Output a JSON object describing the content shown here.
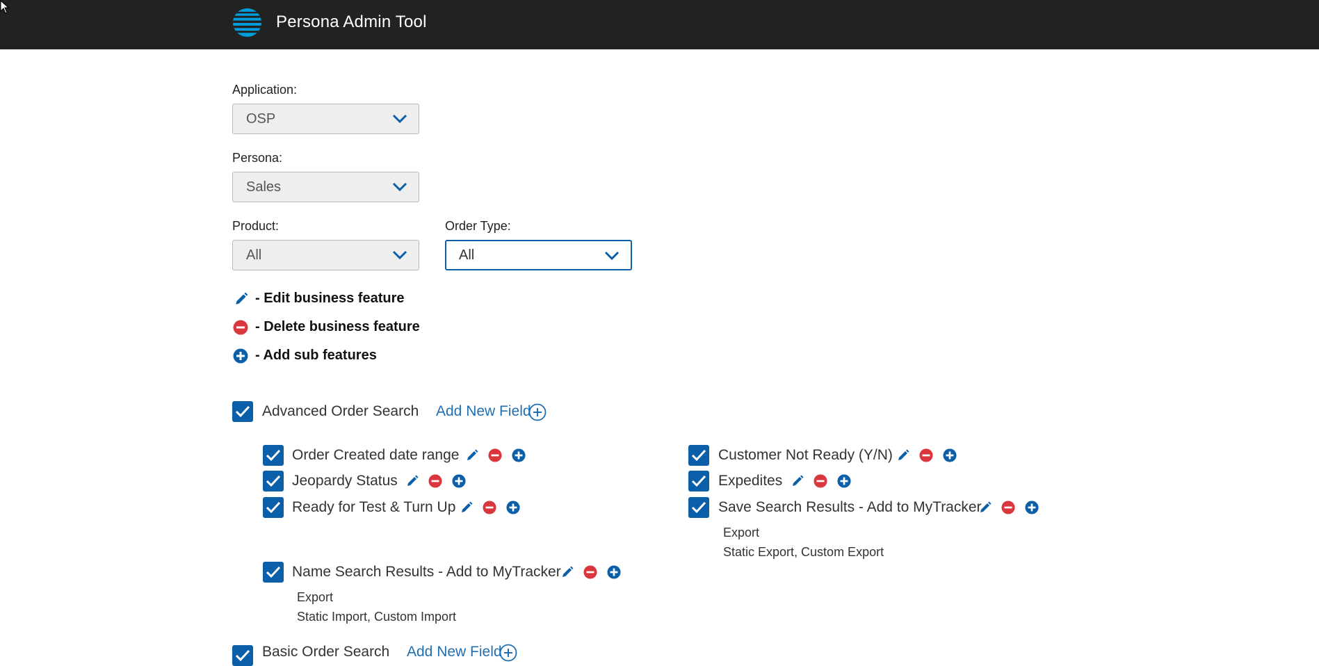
{
  "header": {
    "title": "Persona Admin Tool"
  },
  "filters": {
    "application": {
      "label": "Application:",
      "value": "OSP"
    },
    "persona": {
      "label": "Persona:",
      "value": "Sales"
    },
    "product": {
      "label": "Product:",
      "value": "All"
    },
    "order_type": {
      "label": "Order Type:",
      "value": "All"
    }
  },
  "legend": {
    "edit": "- Edit business feature",
    "delete": "- Delete business feature",
    "add": "- Add sub features"
  },
  "groups": [
    {
      "label": "Advanced Order Search",
      "add_field": "Add New Field",
      "checked": true,
      "items": [
        {
          "label": "Order Created date range",
          "checked": true
        },
        {
          "label": "Jeopardy Status",
          "checked": true
        },
        {
          "label": "Ready for Test & Turn Up",
          "checked": true
        },
        {
          "label": "Name Search Results - Add to MyTracker",
          "checked": true,
          "sub": [
            "Export",
            "Static Import, Custom Import"
          ]
        },
        {
          "label": "Customer Not Ready (Y/N)",
          "checked": true
        },
        {
          "label": "Expedites",
          "checked": true
        },
        {
          "label": "Save Search Results - Add to MyTracker",
          "checked": true,
          "sub": [
            "Export",
            "Static Export, Custom Export"
          ]
        }
      ]
    },
    {
      "label": "Basic Order Search",
      "add_field": "Add New Field",
      "checked": true
    }
  ],
  "colors": {
    "header_bg": "#222222",
    "accent": "#0b5ea8",
    "delete": "#d9363e"
  }
}
